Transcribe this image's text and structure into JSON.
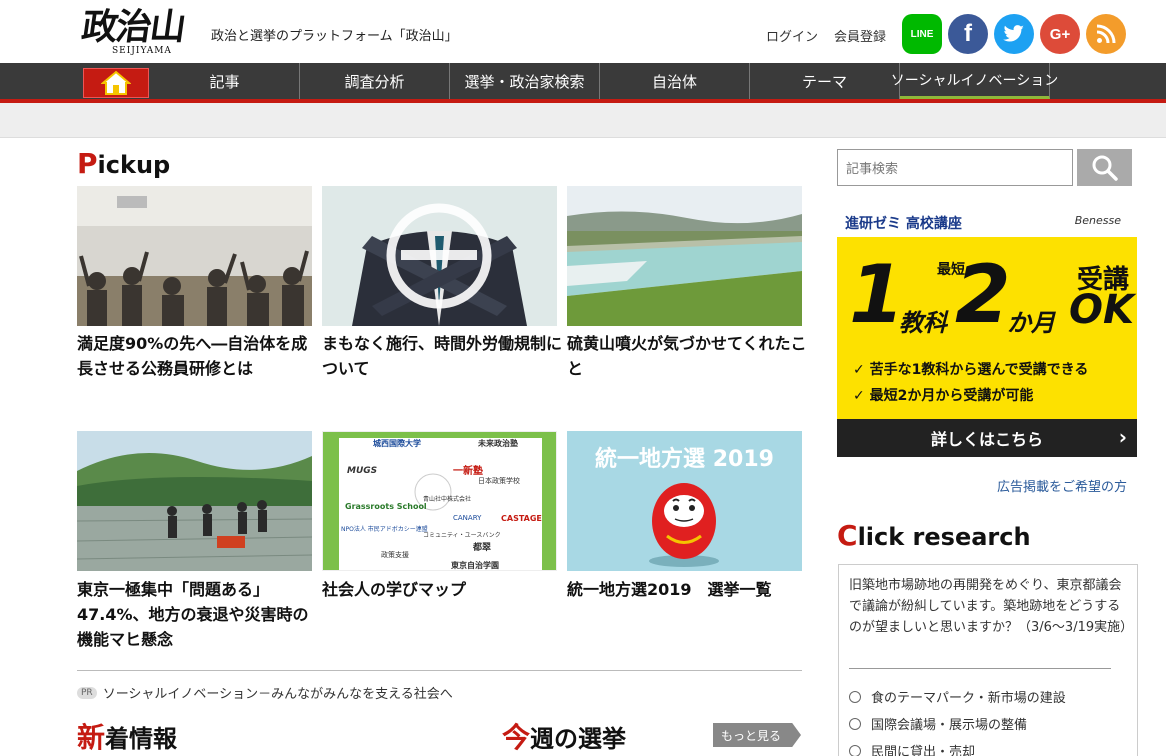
{
  "header": {
    "logo_text": "政治山",
    "logo_sub": "SEIJIYAMA",
    "tagline": "政治と選挙のプラットフォーム「政治山」",
    "login": "ログイン",
    "register": "会員登録",
    "social": {
      "line": "LINE",
      "facebook": "f",
      "gplus": "G+"
    }
  },
  "nav": {
    "items": [
      "記事",
      "調査分析",
      "選挙・政治家検索",
      "自治体",
      "テーマ",
      "ソーシャルイノベーション"
    ]
  },
  "pickup": {
    "title_cap": "P",
    "title_rest": "ickup",
    "cards": [
      {
        "title": "満足度90%の先へ―自治体を成長させる公務員研修とは"
      },
      {
        "title": "まもなく施行、時間外労働規制について"
      },
      {
        "title": "硫黄山噴火が気づかせてくれたこと"
      },
      {
        "title": "東京一極集中「問題ある」47.4%、地方の衰退や災害時の機能マヒ懸念"
      },
      {
        "title": "社会人の学びマップ"
      },
      {
        "title": "統一地方選2019　選挙一覧"
      }
    ],
    "image_texts": {
      "election_banner": "統一地方選 2019",
      "map_labels": [
        "城西国際大学",
        "未来政治塾",
        "MUGS",
        "一新塾",
        "日本政策学校",
        "Grassroots School",
        "青山社中株式会社",
        "NPO法人 市民アドボカシー連盟",
        "CANARY",
        "CASTAGE",
        "コミュニティ・ユースバンク",
        "都翠",
        "政策支援",
        "東京自治学園"
      ]
    }
  },
  "pr": {
    "badge": "PR",
    "text": "ソーシャルイノベーション－みんながみんなを支える社会へ"
  },
  "news": {
    "title_cap": "新",
    "title_rest": "着情報"
  },
  "weekly": {
    "title_cap": "今",
    "title_rest": "週の選挙",
    "more": "もっと見る"
  },
  "sidebar": {
    "search_placeholder": "記事検索",
    "ad": {
      "top_left": "進研ゼミ 高校講座",
      "top_right": "Benesse",
      "num1": "1",
      "kyouka": "教科",
      "saitan": "最短",
      "num2": "2",
      "kagetsu": "か月",
      "jukou": "受講",
      "ok": "OK",
      "line1": "✓ 苦手な1教科から選んで受講できる",
      "line2": "✓ 最短2か月から受講が可能",
      "cta": "詳しくはこちら"
    },
    "ad_link": "広告掲載をご希望の方",
    "click_research": {
      "title_cap": "C",
      "title_rest": "lick research",
      "question": "旧築地市場跡地の再開発をめぐり、東京都議会で議論が紛糾しています。築地跡地をどうするのが望ましいと思いますか？（3/6～3/19実施）",
      "options": [
        "食のテーマパーク・新市場の建設",
        "国際会議場・展示場の整備",
        "民間に貸出・売却"
      ]
    }
  }
}
